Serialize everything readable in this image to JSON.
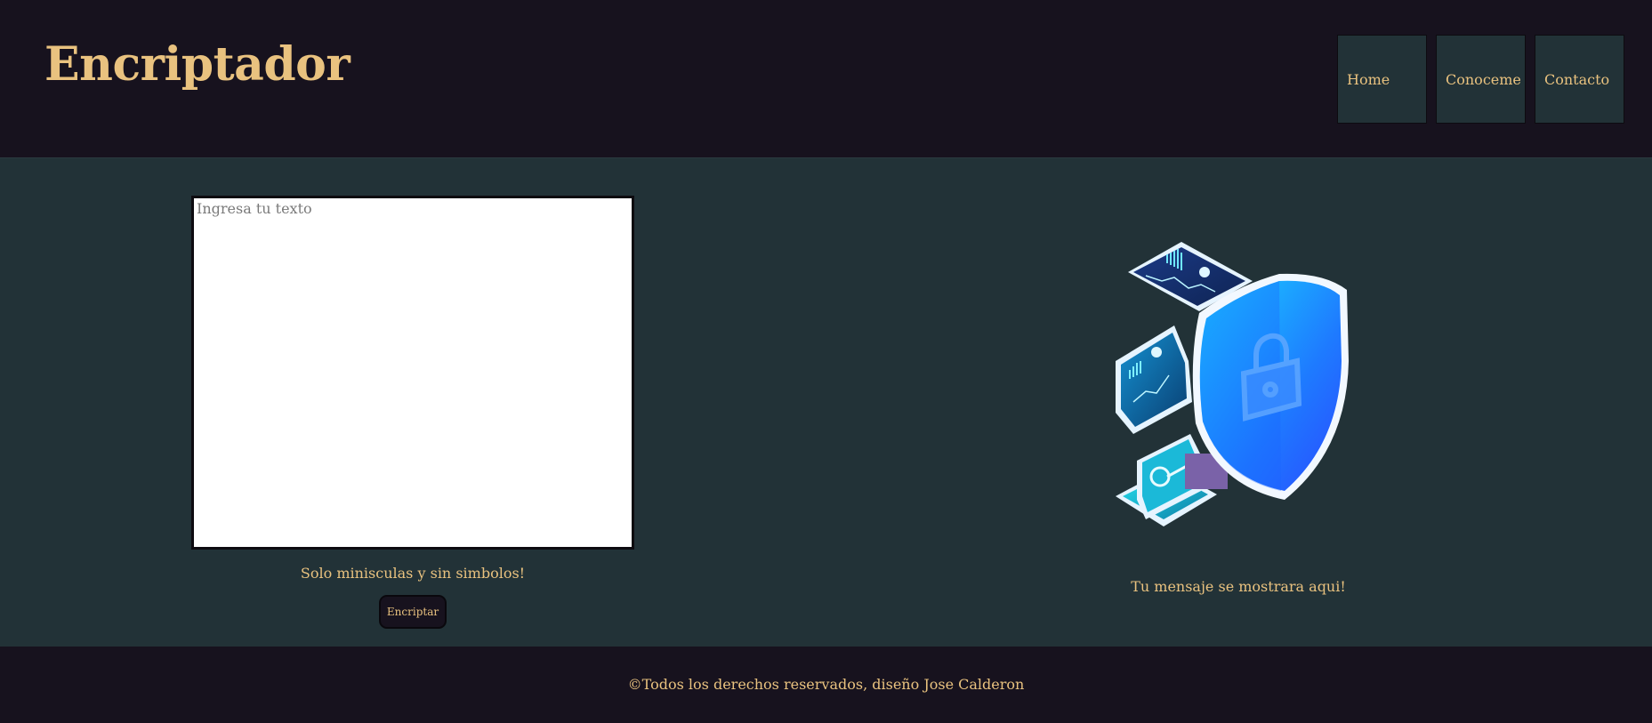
{
  "header": {
    "title": "Encriptador",
    "nav": [
      {
        "label": "Home"
      },
      {
        "label": "Conoceme"
      },
      {
        "label": "Contacto"
      }
    ]
  },
  "main": {
    "input": {
      "placeholder": "Ingresa tu texto",
      "value": ""
    },
    "hint": "Solo minisculas y sin simbolos!",
    "encrypt_button": "Encriptar",
    "illustration_icon": "security-shield-lock-icon",
    "output_message": "Tu mensaje se mostrara aqui!"
  },
  "footer": {
    "copyright": "©Todos los derechos reservados, diseño Jose Calderon"
  },
  "colors": {
    "background_dark": "#17121e",
    "background_main": "#223237",
    "accent_text": "#e9c27f"
  }
}
